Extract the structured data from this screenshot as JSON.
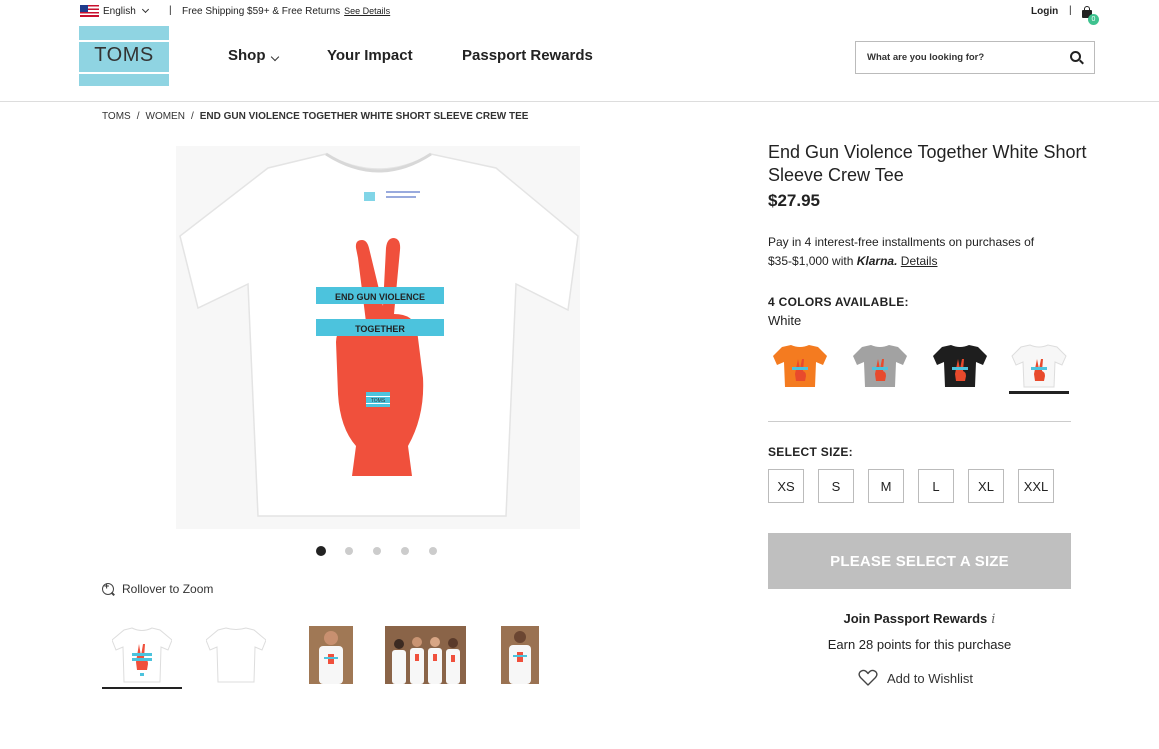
{
  "utility": {
    "language": "English",
    "shipping_text": "Free Shipping $59+ & Free Returns",
    "shipping_link": "See Details",
    "login": "Login",
    "cart_count": "0"
  },
  "header": {
    "logo_text": "TOMS",
    "nav": {
      "shop": "Shop",
      "impact": "Your Impact",
      "passport": "Passport Rewards"
    },
    "search_placeholder": "What are you looking for?"
  },
  "breadcrumb": {
    "items": [
      "TOMS",
      "/",
      "WOMEN",
      "/"
    ],
    "current": "END GUN VIOLENCE TOGETHER WHITE SHORT SLEEVE CREW TEE"
  },
  "gallery": {
    "shirt_text_line1": "END GUN VIOLENCE",
    "shirt_text_line2": "TOGETHER",
    "shirt_logo": "TOMS",
    "dots_total": 5,
    "dot_active": 1,
    "zoom_label": "Rollover to Zoom"
  },
  "product": {
    "title": "End Gun Violence Together White Short Sleeve Crew Tee",
    "price": "$27.95",
    "klarna_text_1": "Pay in 4 interest-free installments on purchases of $35-$1,000 with",
    "klarna_logo": "Klarna.",
    "klarna_details": "Details",
    "colors_label": "4 COLORS AVAILABLE:",
    "selected_color": "White",
    "colors": [
      {
        "name": "orange",
        "hex": "#f47b20"
      },
      {
        "name": "heather grey",
        "hex": "#9e9e9e"
      },
      {
        "name": "black",
        "hex": "#1e1e1e"
      },
      {
        "name": "white",
        "hex": "#f4f4f4"
      }
    ],
    "size_label": "SELECT SIZE:",
    "sizes": [
      "XS",
      "S",
      "M",
      "L",
      "XL",
      "XXL"
    ],
    "add_button": "PLEASE SELECT A SIZE",
    "join_text": "Join Passport Rewards",
    "info_glyph": "i",
    "earn_text": "Earn 28 points for this purchase",
    "wishlist": "Add to Wishlist"
  },
  "colors": {
    "accent_red": "#f0503c",
    "accent_blue": "#4cc3dd",
    "logo_blue": "#8fd4e2",
    "disabled_button": "#bfbfbf"
  }
}
